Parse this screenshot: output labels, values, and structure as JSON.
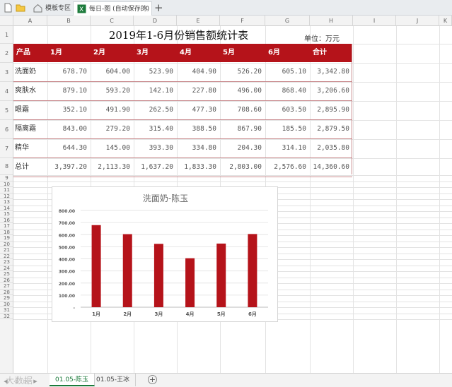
{
  "tabs": [
    {
      "label": "模板专区",
      "active": false
    },
    {
      "label": "每日-图 (自动保存的)",
      "active": true
    }
  ],
  "columns": [
    "A",
    "B",
    "C",
    "D",
    "E",
    "F",
    "G",
    "H",
    "I",
    "J",
    "K"
  ],
  "rows": [
    "1",
    "2",
    "3",
    "4",
    "5",
    "6",
    "7",
    "8",
    "9",
    "10",
    "11",
    "12",
    "13",
    "14",
    "15",
    "16",
    "17",
    "18",
    "19",
    "20",
    "21",
    "22",
    "23",
    "24",
    "25",
    "26",
    "27",
    "28",
    "29",
    "30",
    "31",
    "32"
  ],
  "sheet": {
    "title": "2019年1-6月份销售额统计表",
    "unit": "单位：万元",
    "headers": [
      "产品",
      "1月",
      "2月",
      "3月",
      "4月",
      "5月",
      "6月",
      "合计"
    ],
    "rows": [
      [
        "洗面奶",
        "678.70",
        "604.00",
        "523.90",
        "404.90",
        "526.20",
        "605.10",
        "3,342.80"
      ],
      [
        "爽肤水",
        "879.10",
        "593.20",
        "142.10",
        "227.80",
        "496.00",
        "868.40",
        "3,206.60"
      ],
      [
        "眼霜",
        "352.10",
        "491.90",
        "262.50",
        "477.30",
        "708.60",
        "603.50",
        "2,895.90"
      ],
      [
        "隔离霜",
        "843.00",
        "279.20",
        "315.40",
        "388.50",
        "867.90",
        "185.50",
        "2,879.50"
      ],
      [
        "精华",
        "644.30",
        "145.00",
        "393.30",
        "334.80",
        "204.30",
        "314.10",
        "2,035.80"
      ],
      [
        "总计",
        "3,397.20",
        "2,113.30",
        "1,637.20",
        "1,833.30",
        "2,803.00",
        "2,576.60",
        "14,360.60"
      ]
    ]
  },
  "chart_data": {
    "type": "bar",
    "title": "洗面奶-陈玉",
    "categories": [
      "1月",
      "2月",
      "3月",
      "4月",
      "5月",
      "6月"
    ],
    "values": [
      678.7,
      604.0,
      523.9,
      404.9,
      526.2,
      605.1
    ],
    "ylim": [
      0,
      800
    ],
    "ytick_labels": [
      "-",
      "100.00",
      "200.00",
      "300.00",
      "400.00",
      "500.00",
      "600.00",
      "700.00",
      "800.00"
    ],
    "grid": true,
    "bar_color": "#b5131a"
  },
  "sheet_tabs": [
    {
      "label": "01.05-陈玉",
      "active": true
    },
    {
      "label": "01.05-王冰",
      "active": false
    }
  ],
  "watermark": "大数据"
}
